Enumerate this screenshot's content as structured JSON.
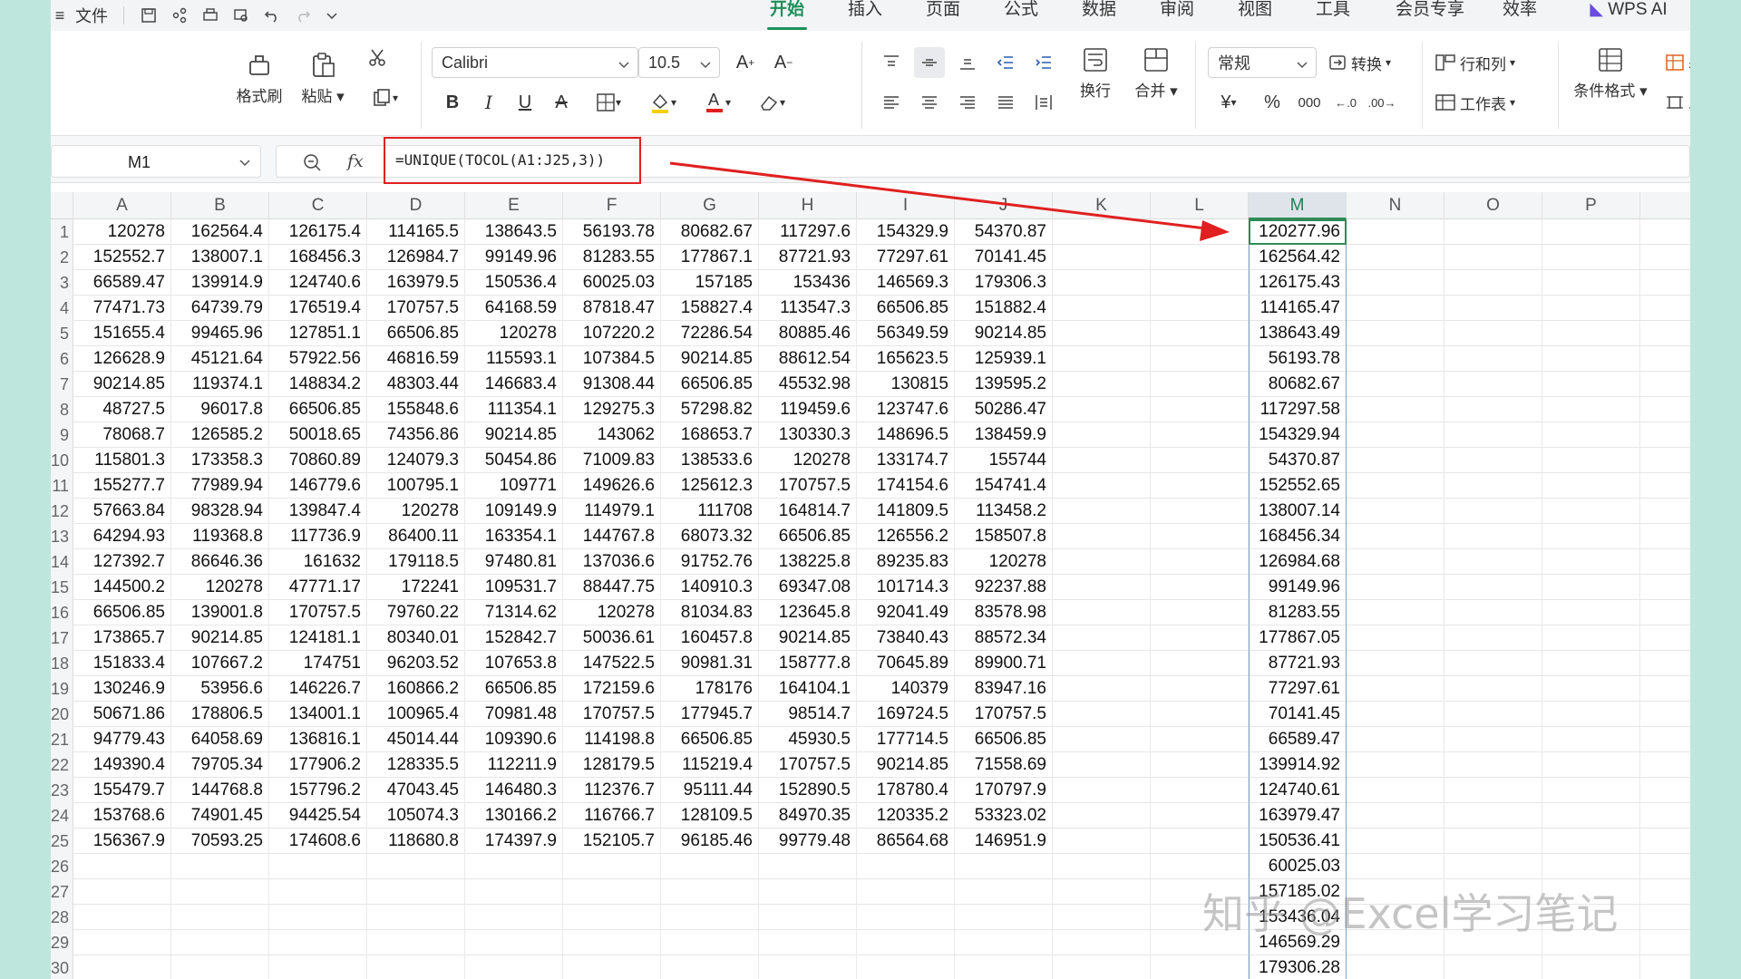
{
  "menubar": {
    "menu_icon": "≡",
    "file_label": "文件",
    "tabs": [
      {
        "label": "开始",
        "active": true
      },
      {
        "label": "插入"
      },
      {
        "label": "页面"
      },
      {
        "label": "公式"
      },
      {
        "label": "数据"
      },
      {
        "label": "审阅"
      },
      {
        "label": "视图"
      },
      {
        "label": "工具"
      },
      {
        "label": "会员专享"
      },
      {
        "label": "效率"
      },
      {
        "label": "WPS AI"
      }
    ]
  },
  "ribbon": {
    "format_painter": "格式刷",
    "paste": "粘贴",
    "font_name": "Calibri",
    "font_size": "10.5",
    "number_format": "常规",
    "convert": "转换",
    "rows_cols": "行和列",
    "worksheet": "工作表",
    "wrap": "换行",
    "merge": "合并",
    "cond_format": "条件格式",
    "table_style": "表格样",
    "cell_style": "单元格",
    "currency_symbol": "¥",
    "percent_symbol": "%",
    "thousands_symbol": "000"
  },
  "formula_bar": {
    "cell_ref": "M1",
    "fx": "fx",
    "formula": "=UNIQUE(TOCOL(A1:J25,3))"
  },
  "columns": [
    "A",
    "B",
    "C",
    "D",
    "E",
    "F",
    "G",
    "H",
    "I",
    "J",
    "K",
    "L",
    "M",
    "N",
    "O",
    "P"
  ],
  "row_labels": [
    "1",
    "2",
    "3",
    "4",
    "5",
    "6",
    "7",
    "8",
    "9",
    "10",
    "11",
    "12",
    "13",
    "14",
    "15",
    "16",
    "17",
    "18",
    "19",
    "20",
    "21",
    "22",
    "23",
    "24",
    "25",
    "26",
    "27",
    "28",
    "29",
    "30"
  ],
  "grid": [
    [
      "120278",
      "162564.4",
      "126175.4",
      "114165.5",
      "138643.5",
      "56193.78",
      "80682.67",
      "117297.6",
      "154329.9",
      "54370.87"
    ],
    [
      "152552.7",
      "138007.1",
      "168456.3",
      "126984.7",
      "99149.96",
      "81283.55",
      "177867.1",
      "87721.93",
      "77297.61",
      "70141.45"
    ],
    [
      "66589.47",
      "139914.9",
      "124740.6",
      "163979.5",
      "150536.4",
      "60025.03",
      "157185",
      "153436",
      "146569.3",
      "179306.3"
    ],
    [
      "77471.73",
      "64739.79",
      "176519.4",
      "170757.5",
      "64168.59",
      "87818.47",
      "158827.4",
      "113547.3",
      "66506.85",
      "151882.4"
    ],
    [
      "151655.4",
      "99465.96",
      "127851.1",
      "66506.85",
      "120278",
      "107220.2",
      "72286.54",
      "80885.46",
      "56349.59",
      "90214.85"
    ],
    [
      "126628.9",
      "45121.64",
      "57922.56",
      "46816.59",
      "115593.1",
      "107384.5",
      "90214.85",
      "88612.54",
      "165623.5",
      "125939.1"
    ],
    [
      "90214.85",
      "119374.1",
      "148834.2",
      "48303.44",
      "146683.4",
      "91308.44",
      "66506.85",
      "45532.98",
      "130815",
      "139595.2"
    ],
    [
      "48727.5",
      "96017.8",
      "66506.85",
      "155848.6",
      "111354.1",
      "129275.3",
      "57298.82",
      "119459.6",
      "123747.6",
      "50286.47"
    ],
    [
      "78068.7",
      "126585.2",
      "50018.65",
      "74356.86",
      "90214.85",
      "143062",
      "168653.7",
      "130330.3",
      "148696.5",
      "138459.9"
    ],
    [
      "115801.3",
      "173358.3",
      "70860.89",
      "124079.3",
      "50454.86",
      "71009.83",
      "138533.6",
      "120278",
      "133174.7",
      "155744"
    ],
    [
      "155277.7",
      "77989.94",
      "146779.6",
      "100795.1",
      "109771",
      "149626.6",
      "125612.3",
      "170757.5",
      "174154.6",
      "154741.4"
    ],
    [
      "57663.84",
      "98328.94",
      "139847.4",
      "120278",
      "109149.9",
      "114979.1",
      "111708",
      "164814.7",
      "141809.5",
      "113458.2"
    ],
    [
      "64294.93",
      "119368.8",
      "117736.9",
      "86400.11",
      "163354.1",
      "144767.8",
      "68073.32",
      "66506.85",
      "126556.2",
      "158507.8"
    ],
    [
      "127392.7",
      "86646.36",
      "161632",
      "179118.5",
      "97480.81",
      "137036.6",
      "91752.76",
      "138225.8",
      "89235.83",
      "120278"
    ],
    [
      "144500.2",
      "120278",
      "47771.17",
      "172241",
      "109531.7",
      "88447.75",
      "140910.3",
      "69347.08",
      "101714.3",
      "92237.88"
    ],
    [
      "66506.85",
      "139001.8",
      "170757.5",
      "79760.22",
      "71314.62",
      "120278",
      "81034.83",
      "123645.8",
      "92041.49",
      "83578.98"
    ],
    [
      "173865.7",
      "90214.85",
      "124181.1",
      "80340.01",
      "152842.7",
      "50036.61",
      "160457.8",
      "90214.85",
      "73840.43",
      "88572.34"
    ],
    [
      "151833.4",
      "107667.2",
      "174751",
      "96203.52",
      "107653.8",
      "147522.5",
      "90981.31",
      "158777.8",
      "70645.89",
      "89900.71"
    ],
    [
      "130246.9",
      "53956.6",
      "146226.7",
      "160866.2",
      "66506.85",
      "172159.6",
      "178176",
      "164104.1",
      "140379",
      "83947.16"
    ],
    [
      "50671.86",
      "178806.5",
      "134001.1",
      "100965.4",
      "70981.48",
      "170757.5",
      "177945.7",
      "98514.7",
      "169724.5",
      "170757.5"
    ],
    [
      "94779.43",
      "64058.69",
      "136816.1",
      "45014.44",
      "109390.6",
      "114198.8",
      "66506.85",
      "45930.5",
      "177714.5",
      "66506.85"
    ],
    [
      "149390.4",
      "79705.34",
      "177906.2",
      "128335.5",
      "112211.9",
      "128179.5",
      "115219.4",
      "170757.5",
      "90214.85",
      "71558.69"
    ],
    [
      "155479.7",
      "144768.8",
      "157796.2",
      "47043.45",
      "146480.3",
      "112376.7",
      "95111.44",
      "152890.5",
      "178780.4",
      "170797.9"
    ],
    [
      "153768.6",
      "74901.45",
      "94425.54",
      "105074.3",
      "130166.2",
      "116766.7",
      "128109.5",
      "84970.35",
      "120335.2",
      "53323.02"
    ],
    [
      "156367.9",
      "70593.25",
      "174608.6",
      "118680.8",
      "174397.9",
      "152105.7",
      "96185.46",
      "99779.48",
      "86564.68",
      "146951.9"
    ]
  ],
  "column_m": [
    "120277.96",
    "162564.42",
    "126175.43",
    "114165.47",
    "138643.49",
    "56193.78",
    "80682.67",
    "117297.58",
    "154329.94",
    "54370.87",
    "152552.65",
    "138007.14",
    "168456.34",
    "126984.68",
    "99149.96",
    "81283.55",
    "177867.05",
    "87721.93",
    "77297.61",
    "70141.45",
    "66589.47",
    "139914.92",
    "124740.61",
    "163979.47",
    "150536.41",
    "60025.03",
    "157185.02",
    "153436.04",
    "146569.29",
    "179306.28"
  ],
  "watermark": "知乎 @Excel学习笔记",
  "colors": {
    "accent": "#1e8f5a",
    "highlight": "#e02020",
    "selection": "#2e8b57"
  }
}
